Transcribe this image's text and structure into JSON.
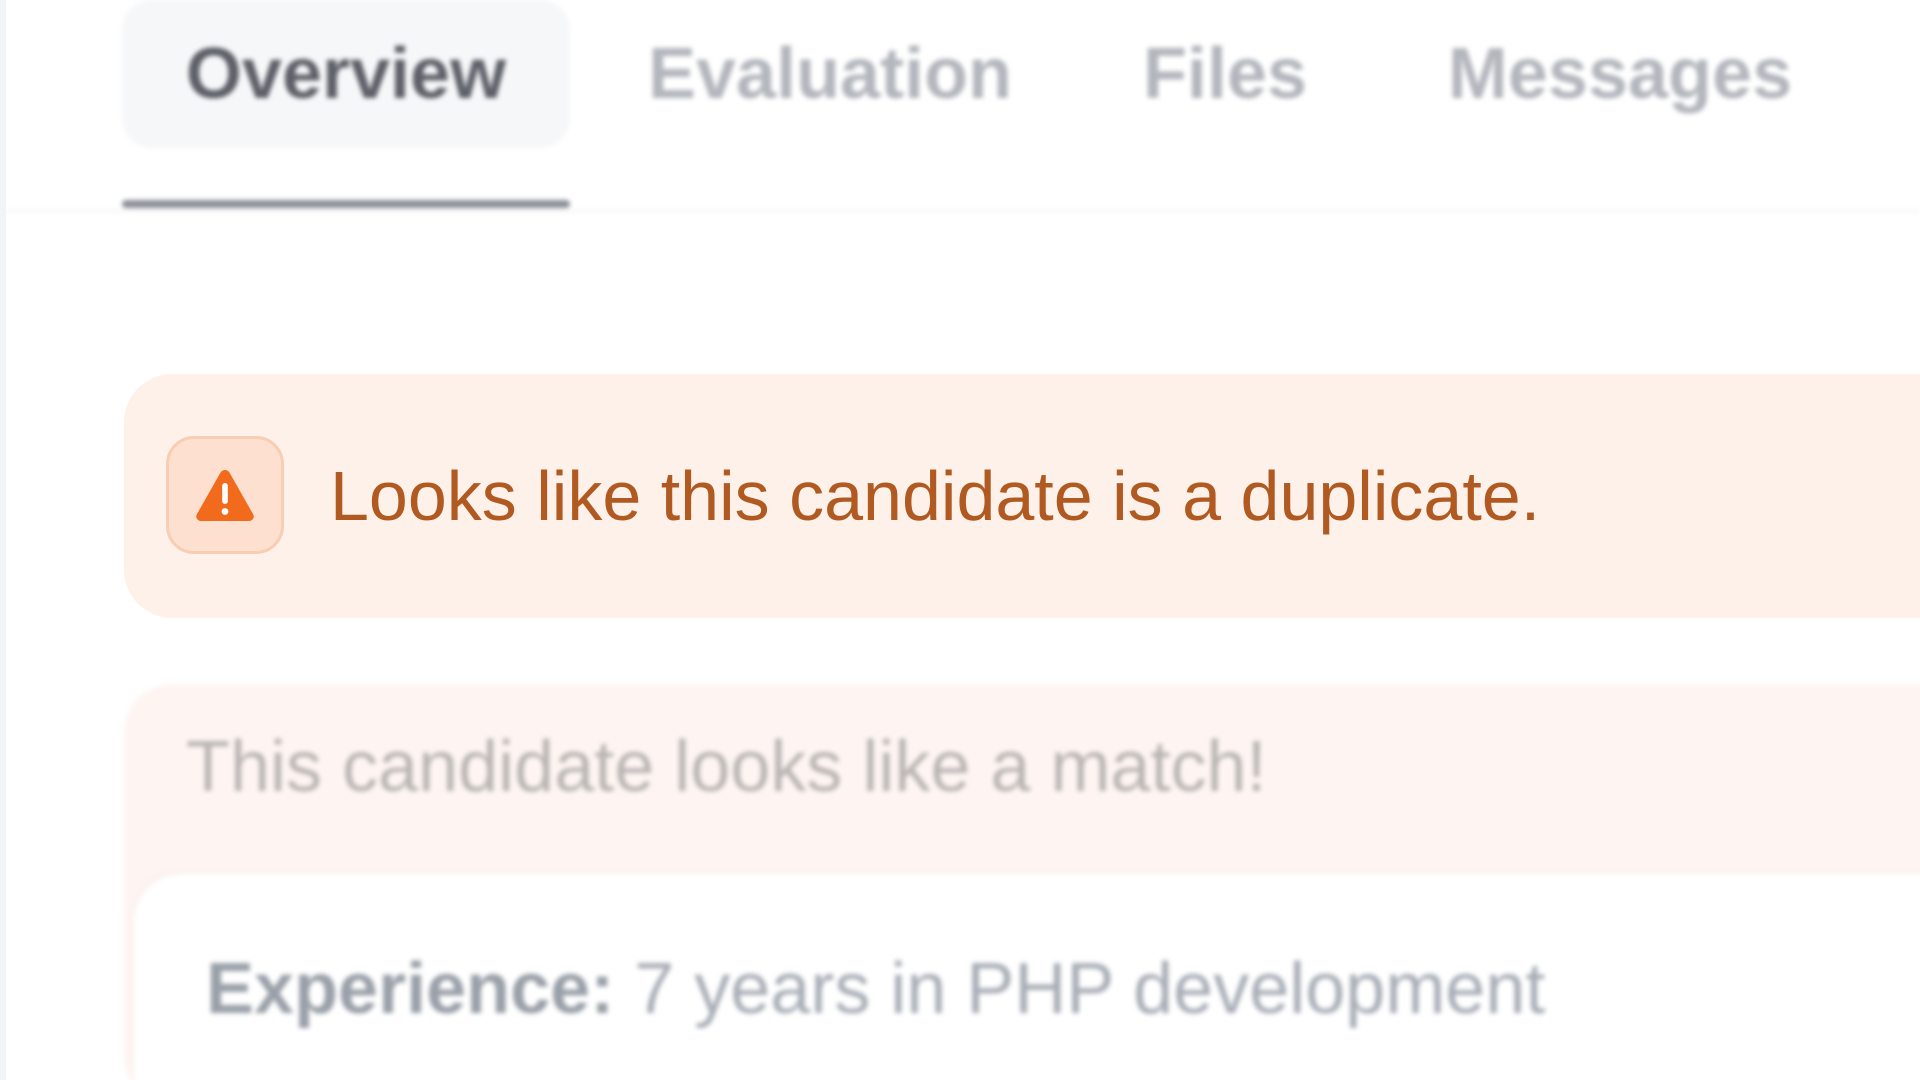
{
  "tabs": [
    {
      "label": "Overview",
      "active": true
    },
    {
      "label": "Evaluation",
      "active": false
    },
    {
      "label": "Files",
      "active": false
    },
    {
      "label": "Messages",
      "active": false
    }
  ],
  "alert": {
    "icon": "warning-triangle-icon",
    "message": "Looks like this candidate is a duplicate.",
    "color": "#b05a22",
    "icon_color": "#f26b1d"
  },
  "match_card": {
    "title": "This candidate looks like a match!",
    "experience_label": "Experience:",
    "experience_value": " 7 years in PHP development"
  }
}
